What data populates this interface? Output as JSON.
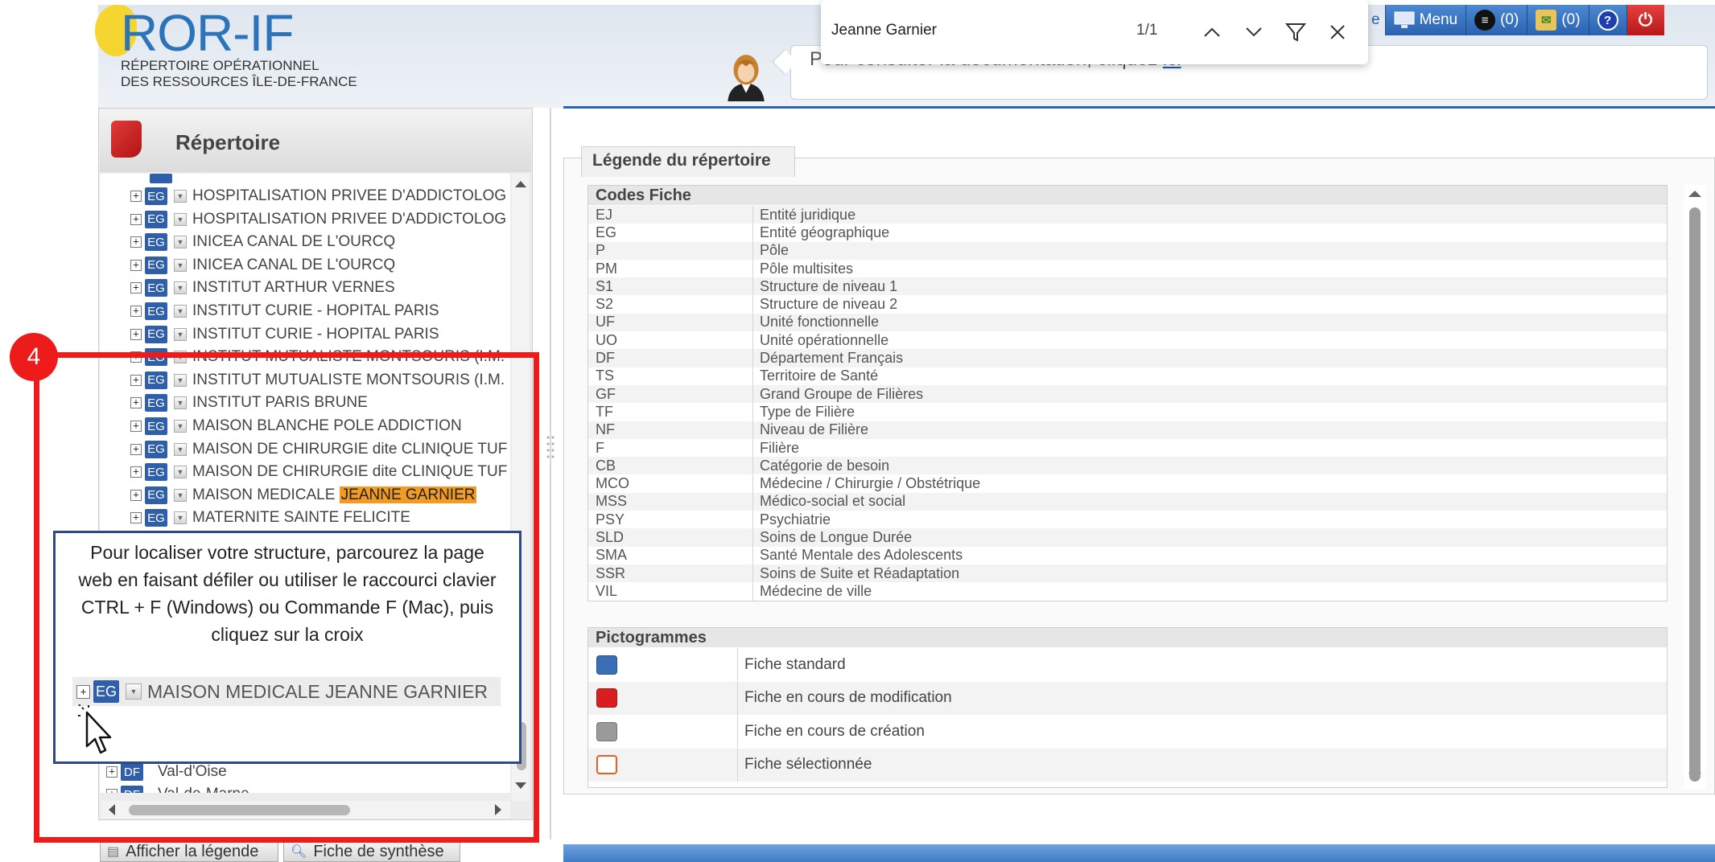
{
  "logo": {
    "title": "ROR-IF",
    "line1": "RÉPERTOIRE OPÉRATIONNEL",
    "line2": "DES RESSOURCES ÎLE-DE-FRANCE"
  },
  "doc_banner": {
    "text": "Pour consulter la documentation, cliquez ",
    "link": "ici"
  },
  "toolbar": {
    "partial_label": "e",
    "menu": "Menu",
    "count1": "(0)",
    "count2": "(0)",
    "help": "?",
    "power": "⏻"
  },
  "findbar": {
    "query": "Jeanne Garnier",
    "count": "1/1"
  },
  "repertoire": {
    "title": "Répertoire",
    "rows": [
      {
        "badge": "EG",
        "label": "HOSPITALISATION PRIVEE D'ADDICTOLOG"
      },
      {
        "badge": "EG",
        "label": "HOSPITALISATION PRIVEE D'ADDICTOLOG"
      },
      {
        "badge": "EG",
        "label": "INICEA CANAL DE L'OURCQ"
      },
      {
        "badge": "EG",
        "label": "INICEA CANAL DE L'OURCQ"
      },
      {
        "badge": "EG",
        "label": "INSTITUT ARTHUR VERNES"
      },
      {
        "badge": "EG",
        "label": "INSTITUT CURIE - HOPITAL PARIS"
      },
      {
        "badge": "EG",
        "label": "INSTITUT CURIE - HOPITAL PARIS"
      },
      {
        "badge": "EG",
        "label": "INSTITUT MUTUALISTE MONTSOURIS (I.M."
      },
      {
        "badge": "EG",
        "label": "INSTITUT MUTUALISTE MONTSOURIS (I.M."
      },
      {
        "badge": "EG",
        "label": "INSTITUT PARIS BRUNE"
      },
      {
        "badge": "EG",
        "label": "MAISON BLANCHE POLE ADDICTION"
      },
      {
        "badge": "EG",
        "label": "MAISON DE CHIRURGIE dite CLINIQUE TUF"
      },
      {
        "badge": "EG",
        "label": "MAISON DE CHIRURGIE dite CLINIQUE TUF"
      },
      {
        "badge": "EG",
        "label": "MAISON MEDICALE ",
        "highlight": "JEANNE GARNIER"
      },
      {
        "badge": "EG",
        "label": "MATERNITE SAINTE FELICITE"
      }
    ],
    "dept_rows": [
      {
        "badge": "DF",
        "label": "Val-d'Oise"
      },
      {
        "badge": "DF",
        "label": "Val-de-Marne"
      }
    ]
  },
  "bottom_buttons": {
    "legend": "Afficher la légende",
    "synthese": "Fiche de synthèse"
  },
  "legend": {
    "title": "Légende du répertoire",
    "codes_title": "Codes Fiche",
    "codes": [
      {
        "code": "EJ",
        "label": "Entité juridique"
      },
      {
        "code": "EG",
        "label": "Entité géographique"
      },
      {
        "code": "P",
        "label": "Pôle"
      },
      {
        "code": "PM",
        "label": "Pôle multisites"
      },
      {
        "code": "S1",
        "label": "Structure de niveau 1"
      },
      {
        "code": "S2",
        "label": "Structure de niveau 2"
      },
      {
        "code": "UF",
        "label": "Unité fonctionnelle"
      },
      {
        "code": "UO",
        "label": "Unité opérationnelle"
      },
      {
        "code": "DF",
        "label": "Département Français"
      },
      {
        "code": "TS",
        "label": "Territoire de Santé"
      },
      {
        "code": "GF",
        "label": "Grand Groupe de Filières"
      },
      {
        "code": "TF",
        "label": "Type de Filière"
      },
      {
        "code": "NF",
        "label": "Niveau de Filière"
      },
      {
        "code": "F",
        "label": "Filière"
      },
      {
        "code": "CB",
        "label": "Catégorie de besoin"
      },
      {
        "code": "MCO",
        "label": "Médecine / Chirurgie / Obstétrique"
      },
      {
        "code": "MSS",
        "label": "Médico-social et social"
      },
      {
        "code": "PSY",
        "label": "Psychiatrie"
      },
      {
        "code": "SLD",
        "label": "Soins de Longue Durée"
      },
      {
        "code": "SMA",
        "label": "Santé Mentale des Adolescents"
      },
      {
        "code": "SSR",
        "label": "Soins de Suite et Réadaptation"
      },
      {
        "code": "VIL",
        "label": "Médecine de ville"
      }
    ],
    "picto_title": "Pictogrammes",
    "pictos": [
      {
        "label": "Fiche standard",
        "color": "#3a6fb8"
      },
      {
        "label": "Fiche en cours de modification",
        "color": "#d81e1e"
      },
      {
        "label": "Fiche en cours de création",
        "color": "#9a9a9a"
      },
      {
        "label": "Fiche sélectionnée",
        "color": "#ffffff",
        "border": "#f05a28"
      }
    ]
  },
  "overlay": {
    "step_number": "4",
    "callout_text": "Pour localiser votre structure, parcourez la page web en faisant défiler ou utiliser le raccourci clavier CTRL + F (Windows) ou Commande F (Mac), puis cliquez sur la croix",
    "example_row": {
      "badge": "EG",
      "label": "MAISON MEDICALE JEANNE GARNIER"
    }
  },
  "colors": {
    "accent_blue": "#2c67b5",
    "step_red": "#ee1b1b",
    "highlight_orange": "#f29b24"
  }
}
